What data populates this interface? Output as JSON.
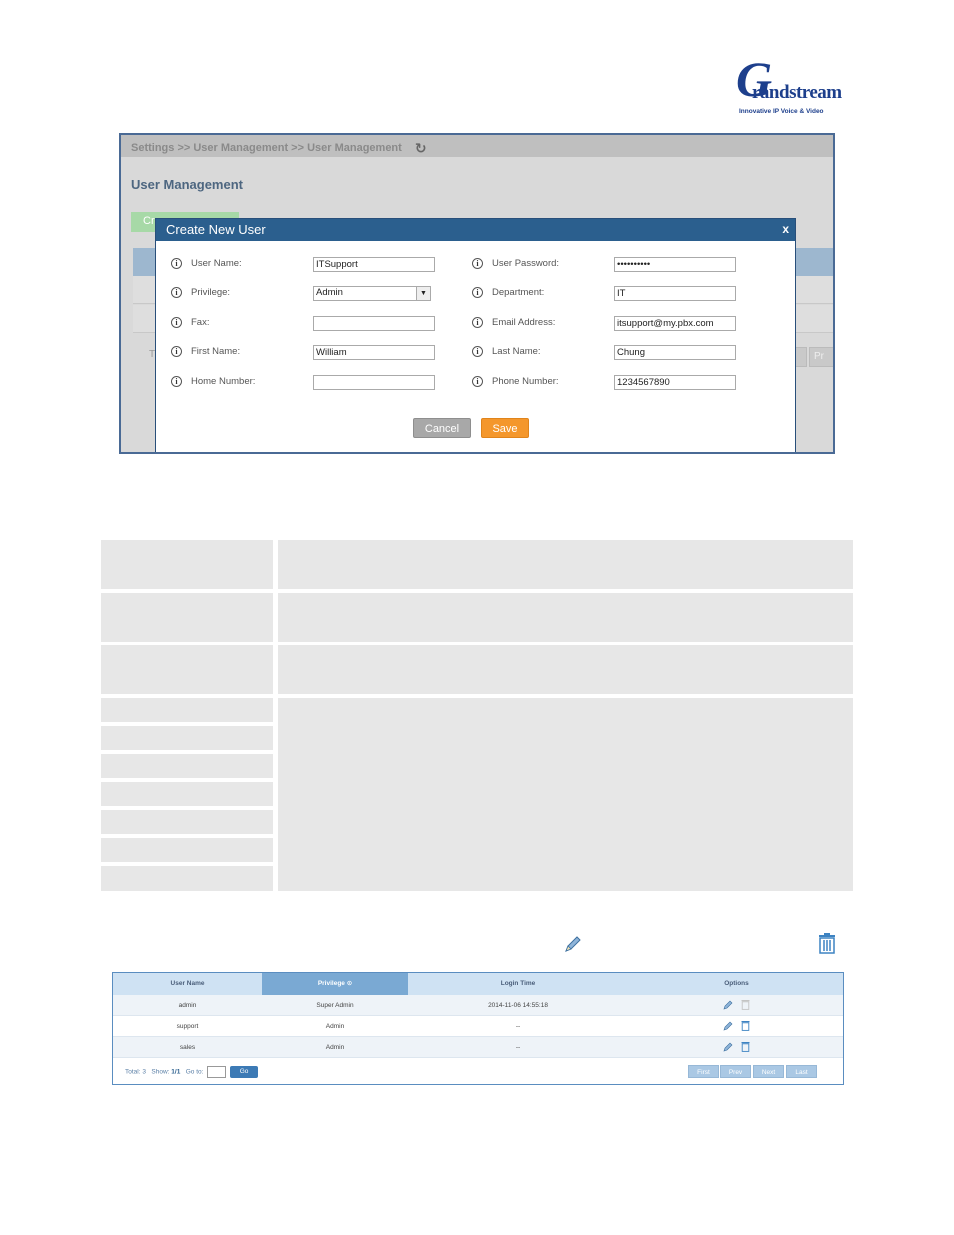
{
  "logo": {
    "brand": "randstream",
    "big_letter": "G",
    "tagline": "Innovative IP Voice & Video"
  },
  "screenshot1": {
    "breadcrumb": "Settings >> User Management >> User Management",
    "page_title": "User Management",
    "create_button": "Cr",
    "bg_total": "T",
    "bg_page_btn": "Pr",
    "modal": {
      "title": "Create New User",
      "close": "x",
      "fields": {
        "user_name": {
          "label": "User Name:",
          "value": "ITSupport"
        },
        "user_password": {
          "label": "User Password:",
          "value": "••••••••••"
        },
        "privilege": {
          "label": "Privilege:",
          "value": "Admin"
        },
        "department": {
          "label": "Department:",
          "value": "IT"
        },
        "fax": {
          "label": "Fax:",
          "value": ""
        },
        "email": {
          "label": "Email Address:",
          "value": "itsupport@my.pbx.com"
        },
        "first_name": {
          "label": "First Name:",
          "value": "William"
        },
        "last_name": {
          "label": "Last Name:",
          "value": "Chung"
        },
        "home_number": {
          "label": "Home Number:",
          "value": ""
        },
        "phone_number": {
          "label": "Phone Number:",
          "value": "1234567890"
        }
      },
      "cancel": "Cancel",
      "save": "Save"
    }
  },
  "user_table": {
    "headers": {
      "user_name": "User Name",
      "privilege": "Privilege ⊙",
      "login_time": "Login Time",
      "options": "Options"
    },
    "rows": [
      {
        "user_name": "admin",
        "privilege": "Super Admin",
        "login_time": "2014-11-06 14:55:18"
      },
      {
        "user_name": "support",
        "privilege": "Admin",
        "login_time": "--"
      },
      {
        "user_name": "sales",
        "privilege": "Admin",
        "login_time": "--"
      }
    ],
    "footer": {
      "total_label": "Total: 3",
      "show_label": "Show:",
      "show_value": "1/1",
      "goto_label": "Go to:",
      "go_button": "Go"
    },
    "pagination": {
      "first": "First",
      "prev": "Prev",
      "next": "Next",
      "last": "Last"
    }
  },
  "colors": {
    "modal_header": "#2b5f8e",
    "save": "#f4972c",
    "cancel": "#a8a8a8",
    "table_header": "#cfe2f3",
    "brand": "#1d3f8c"
  }
}
